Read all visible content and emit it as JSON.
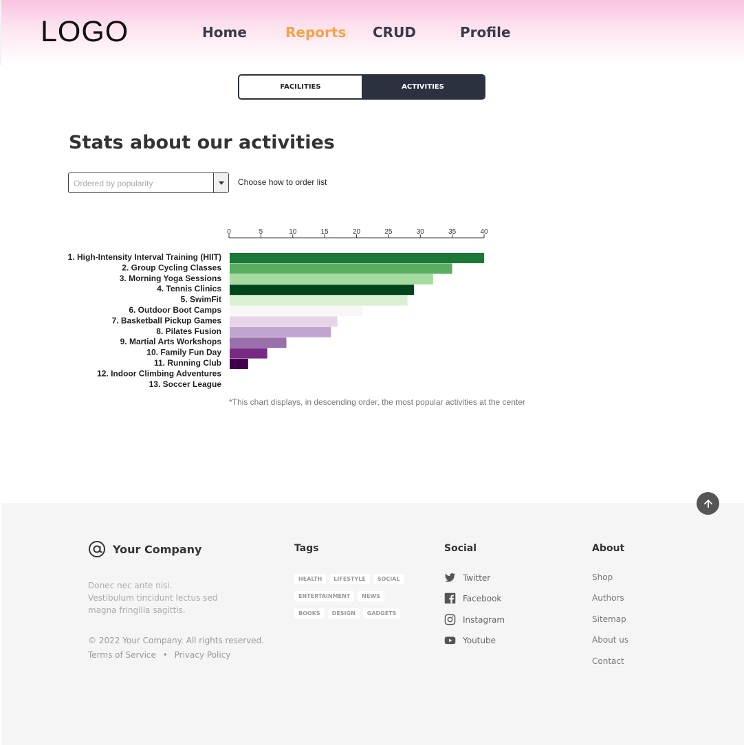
{
  "header": {
    "logo": "LOGO",
    "nav": [
      {
        "label": "Home",
        "active": false
      },
      {
        "label": "Reports",
        "active": true
      },
      {
        "label": "CRUD",
        "active": false
      },
      {
        "label": "Profile",
        "active": false
      }
    ]
  },
  "tabs": [
    {
      "label": "FACILITIES",
      "selected": false
    },
    {
      "label": "ACTIVITIES",
      "selected": true
    }
  ],
  "page_title": "Stats about our activities",
  "order_select": {
    "value": "Ordered by popularity",
    "help": "Choose how to order list"
  },
  "chart_note": "*This chart displays, in descending order, the most popular activities at the center",
  "chart_data": {
    "type": "bar",
    "orientation": "horizontal",
    "xlim": [
      0,
      40
    ],
    "ticks": [
      0,
      5,
      10,
      15,
      20,
      25,
      30,
      35,
      40
    ],
    "categories": [
      "1. High-Intensity Interval Training (HIIT)",
      "2. Group Cycling Classes",
      "3. Morning Yoga Sessions",
      "4. Tennis Clinics",
      "5. SwimFit",
      "6. Outdoor Boot Camps",
      "7. Basketball Pickup Games",
      "8. Pilates Fusion",
      "9. Martial Arts Workshops",
      "10. Family Fun Day",
      "11. Running Club",
      "12. Indoor Climbing Adventures",
      "13. Soccer League"
    ],
    "values": [
      40,
      35,
      32,
      29,
      28,
      21,
      17,
      16,
      9,
      6,
      3,
      0,
      0
    ],
    "bar_values_drawn": [
      40,
      35,
      32,
      29,
      28,
      21,
      17,
      16,
      9,
      6,
      3
    ],
    "colors": [
      "#1b7837",
      "#5aae61",
      "#a6dba0",
      "#00441b",
      "#d9f0d3",
      "#f7f7f7",
      "#e7d4e8",
      "#c2a5cf",
      "#9970ab",
      "#762a83",
      "#40004b"
    ]
  },
  "footer": {
    "company": "Your Company",
    "description": "Donec nec ante nisi. Vestibulum tincidunt lectus sed magna fringilla sagittis.",
    "copyright": "© 2022 Your Company.  All rights reserved.",
    "terms": "Terms of Service",
    "separator": "•",
    "privacy": "Privacy Policy",
    "tags_title": "Tags",
    "tags": [
      [
        "HEALTH",
        "LIFESTYLE",
        "SOCIAL"
      ],
      [
        "ENTERTAINMENT",
        "NEWS"
      ],
      [
        "BOOKS",
        "DESIGN",
        "GADGETS"
      ]
    ],
    "social_title": "Social",
    "social": [
      {
        "label": "Twitter",
        "icon": "twitter-icon"
      },
      {
        "label": "Facebook",
        "icon": "facebook-icon"
      },
      {
        "label": "Instagram",
        "icon": "instagram-icon"
      },
      {
        "label": "Youtube",
        "icon": "youtube-icon"
      }
    ],
    "about_title": "About",
    "about": [
      "Shop",
      "Authors",
      "Sitemap",
      "About us",
      "Contact"
    ]
  }
}
